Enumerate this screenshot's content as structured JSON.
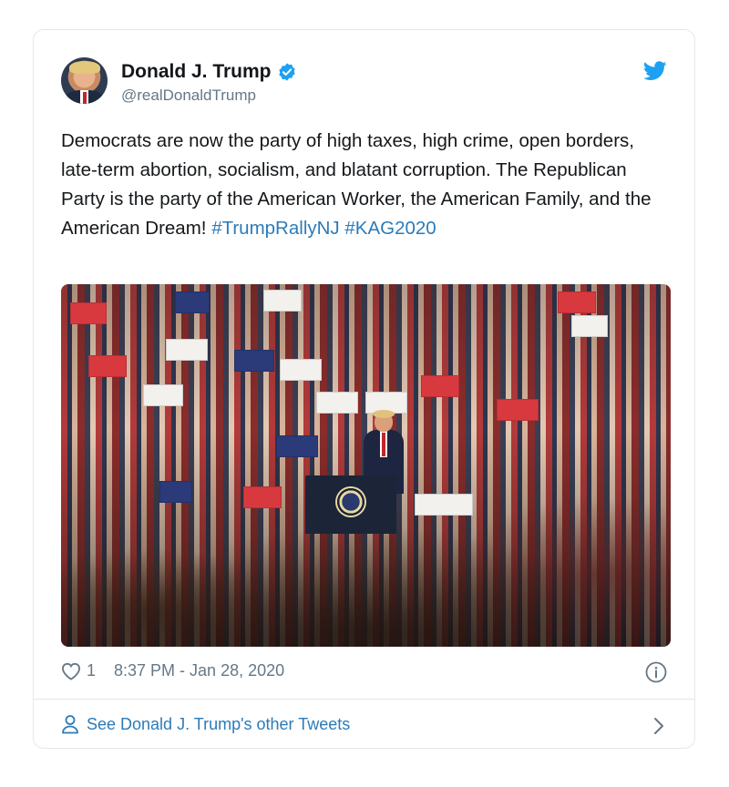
{
  "author": {
    "name": "Donald J. Trump",
    "handle": "@realDonaldTrump"
  },
  "tweet": {
    "text": "Democrats are now the party of high taxes, high crime, open borders, late-term abortion, socialism, and blatant corruption. The Republican Party is the party of the American Worker, the American Family, and the American Dream! ",
    "hashtags": [
      "#TrumpRallyNJ",
      "#KAG2020"
    ]
  },
  "meta": {
    "likes": "1",
    "timestamp": "8:37 PM - Jan 28, 2020"
  },
  "footer": {
    "link_label": "See Donald J. Trump's other Tweets"
  },
  "icons": [
    "verified-badge-icon",
    "twitter-bird-icon",
    "heart-icon",
    "info-icon",
    "person-icon",
    "chevron-right-icon"
  ],
  "colors": {
    "link": "#2b7bb9",
    "secondary_text": "#657786",
    "verified": "#1da1f2",
    "bird": "#1da1f2"
  }
}
